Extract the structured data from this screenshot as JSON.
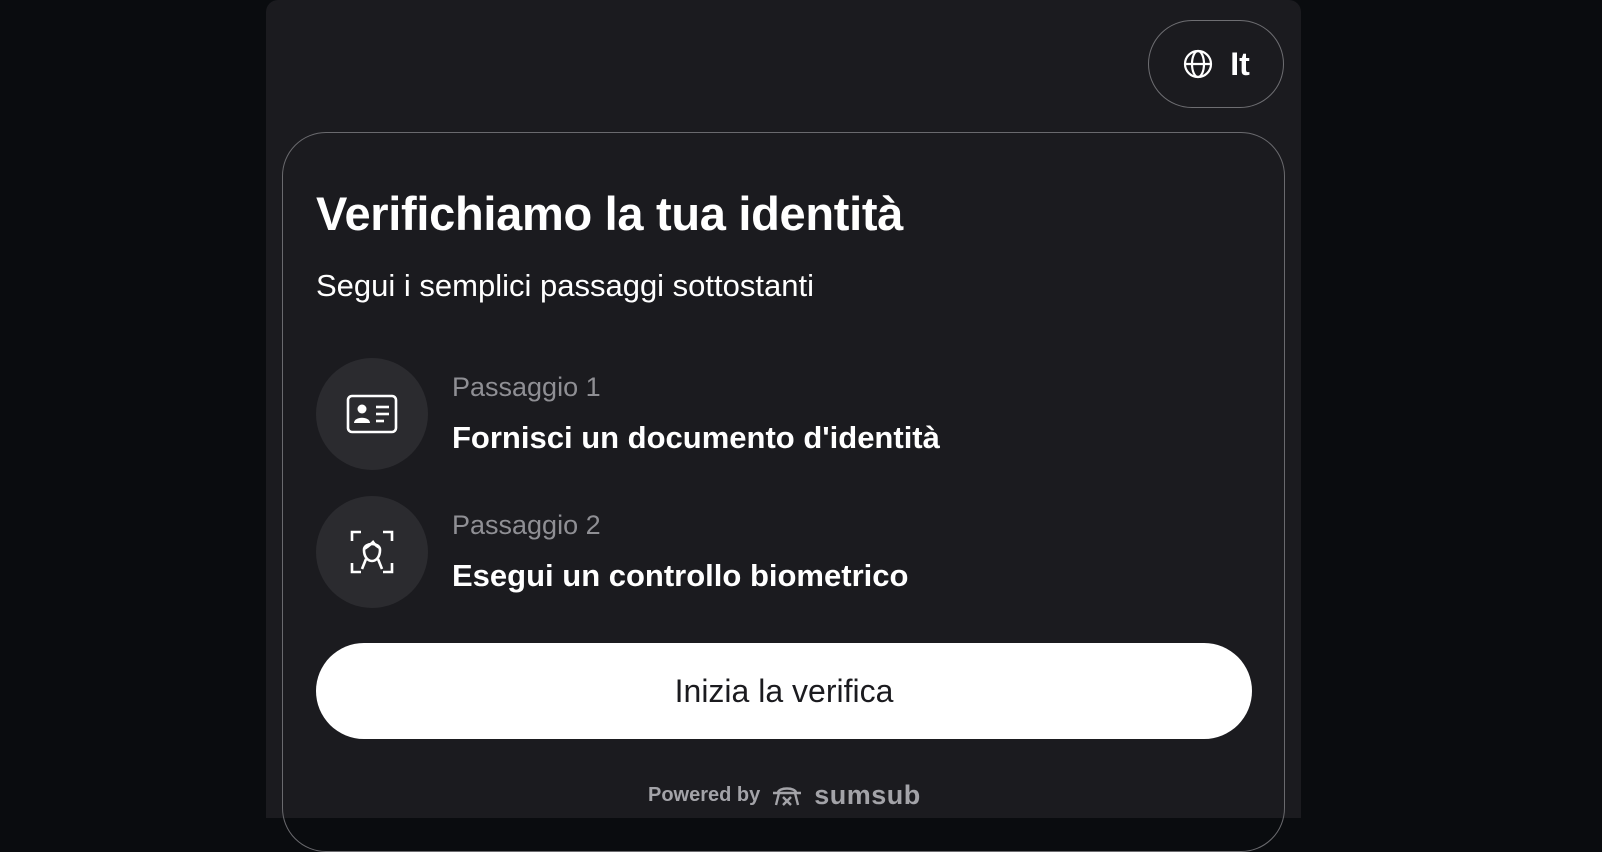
{
  "language": {
    "label": "It",
    "icon": "globe-icon"
  },
  "header": {
    "title": "Verifichiamo la tua identità",
    "subtitle": "Segui i semplici passaggi sottostanti"
  },
  "steps": [
    {
      "label": "Passaggio 1",
      "text": "Fornisci un documento d'identità",
      "icon": "id-card-icon"
    },
    {
      "label": "Passaggio 2",
      "text": "Esegui un controllo biometrico",
      "icon": "face-scan-icon"
    }
  ],
  "cta": {
    "label": "Inizia la verifica"
  },
  "footer": {
    "powered_by": "Powered by",
    "brand": "sumsub"
  },
  "colors": {
    "background": "#0a0c0f",
    "panel": "#1b1b1f",
    "icon_circle": "#2b2b2f",
    "muted_text": "#8f8f94",
    "button": "#ffffff"
  }
}
